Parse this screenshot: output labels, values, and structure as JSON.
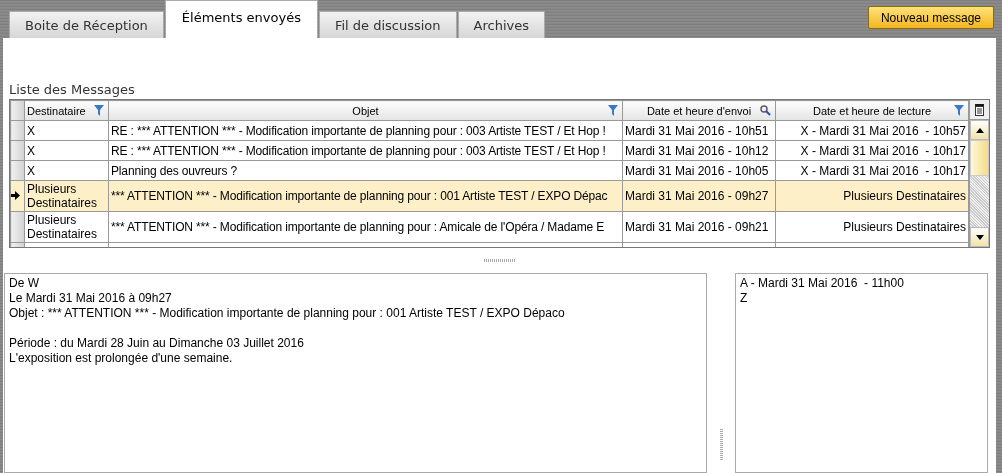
{
  "tabs": [
    {
      "label": "Boite de Réception",
      "selected": false
    },
    {
      "label": "Éléments envoyés",
      "selected": true
    },
    {
      "label": "Fil de discussion",
      "selected": false
    },
    {
      "label": "Archives",
      "selected": false
    }
  ],
  "new_message_button": "Nouveau message",
  "list_title": "Liste des Messages",
  "table": {
    "columns": [
      {
        "label": "Destinataire",
        "kind": "filter"
      },
      {
        "label": "Objet",
        "kind": "filter"
      },
      {
        "label": "Date et heure d'envoi",
        "kind": "search"
      },
      {
        "label": "Date et heure de lecture",
        "kind": "filter"
      }
    ],
    "rows": [
      {
        "selected": false,
        "cells": [
          "X",
          "RE : *** ATTENTION *** - Modification importante de planning pour : 003 Artiste TEST / Et Hop !",
          "Mardi 31 Mai 2016 - 10h51",
          "X - Mardi 31 Mai 2016  - 10h57"
        ]
      },
      {
        "selected": false,
        "cells": [
          "X",
          "RE : *** ATTENTION *** - Modification importante de planning pour : 003 Artiste TEST / Et Hop !",
          "Mardi 31 Mai 2016 - 10h12",
          "X - Mardi 31 Mai 2016  - 10h17"
        ]
      },
      {
        "selected": false,
        "cells": [
          "X",
          "Planning des ouvreurs ?",
          "Mardi 31 Mai 2016 - 10h05",
          "X - Mardi 31 Mai 2016  - 10h17"
        ]
      },
      {
        "selected": true,
        "cells": [
          "Plusieurs Destinataires",
          "*** ATTENTION *** - Modification importante de planning pour : 001 Artiste TEST / EXPO Dépac",
          "Mardi 31 Mai 2016 - 09h27",
          "Plusieurs Destinataires"
        ]
      },
      {
        "selected": false,
        "cells": [
          "Plusieurs Destinataires",
          "*** ATTENTION *** - Modification importante de planning pour : Amicale de l'Opéra / Madame E",
          "Mardi 31 Mai 2016 - 09h21",
          "Plusieurs Destinataires"
        ]
      }
    ]
  },
  "message": {
    "header": [
      "De W",
      "Le Mardi 31 Mai 2016 à 09h27",
      "Objet : *** ATTENTION *** - Modification importante de planning pour : 001 Artiste TEST / EXPO Dépaco"
    ],
    "content": [
      "Période : du Mardi 28 Juin au Dimanche 03 Juillet 2016",
      "L'exposition est prolongée d'une semaine."
    ]
  },
  "read_receipts": [
    "A - Mardi 31 Mai 2016  - 11h00",
    "Z"
  ]
}
